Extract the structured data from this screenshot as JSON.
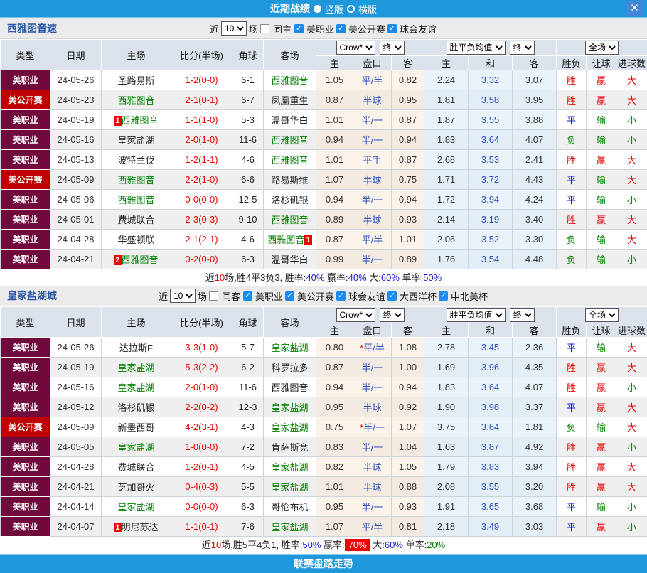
{
  "titlebar": {
    "title": "近期战绩",
    "radios": [
      {
        "label": "竖版",
        "selected": true
      },
      {
        "label": "横版",
        "selected": false
      }
    ],
    "close_label": "✕"
  },
  "header_cols": {
    "type": "类型",
    "date": "日期",
    "home": "主场",
    "score": "比分(半场)",
    "corner": "角球",
    "away": "客场",
    "sub": [
      "主",
      "盘口",
      "客",
      "主",
      "和",
      "客",
      "胜负",
      "让球",
      "进球数"
    ],
    "selects": {
      "crow": "Crow*",
      "final": "终",
      "avg": "胜平负均值",
      "scope": "全场"
    }
  },
  "colors": {
    "accent_blue": "#1f98db",
    "league_mls_bg": "#70093c",
    "league_usopen_bg": "#c00000",
    "focus_team_green": "#008000",
    "score_red": "#f20000",
    "win_red": "#e60000",
    "draw_blue": "#1616d8",
    "lose_green": "#008000",
    "checkbox_blue": "#1b8bf0"
  },
  "sections": [
    {
      "team": "西雅图音速",
      "filter": {
        "near": "近",
        "count": "10",
        "unit": "场",
        "same": {
          "label": "同主",
          "checked": false
        },
        "leagues": [
          {
            "label": "美职业",
            "checked": true
          },
          {
            "label": "美公开赛",
            "checked": true
          },
          {
            "label": "球会友谊",
            "checked": true
          }
        ]
      },
      "rows": [
        {
          "l": "美职业",
          "lc": "mls",
          "d": "24-05-26",
          "h": "圣路易斯",
          "hc": "",
          "hb": "",
          "hba": "",
          "s": "1-2(0-0)",
          "cn": "6-1",
          "a": "西雅图音",
          "ac": "g",
          "ab": "",
          "aba": "",
          "o1": "1.05",
          "p": "平/半",
          "st": false,
          "o2": "0.82",
          "m1": "2.24",
          "m2": "3.32",
          "m3": "3.07",
          "r1": "胜",
          "c1": "r",
          "r2": "赢",
          "c2": "r",
          "r3": "大",
          "c3": "r"
        },
        {
          "l": "美公开赛",
          "lc": "usoc",
          "d": "24-05-23",
          "h": "西雅图音",
          "hc": "g",
          "hb": "",
          "hba": "",
          "s": "2-1(0-1)",
          "cn": "6-7",
          "a": "凤凰重生",
          "ac": "",
          "ab": "",
          "aba": "",
          "o1": "0.87",
          "p": "半球",
          "st": false,
          "o2": "0.95",
          "m1": "1.81",
          "m2": "3.58",
          "m3": "3.95",
          "r1": "胜",
          "c1": "r",
          "r2": "赢",
          "c2": "r",
          "r3": "大",
          "c3": "r"
        },
        {
          "l": "美职业",
          "lc": "mls",
          "d": "24-05-19",
          "h": "西雅图音",
          "hc": "g",
          "hb": "1",
          "hba": "",
          "s": "1-1(1-0)",
          "cn": "5-3",
          "a": "温哥华白",
          "ac": "",
          "ab": "",
          "aba": "",
          "o1": "1.01",
          "p": "半/一",
          "st": false,
          "o2": "0.87",
          "m1": "1.87",
          "m2": "3.55",
          "m3": "3.88",
          "r1": "平",
          "c1": "b",
          "r2": "输",
          "c2": "g",
          "r3": "小",
          "c3": "g"
        },
        {
          "l": "美职业",
          "lc": "mls",
          "d": "24-05-16",
          "h": "皇家盐湖",
          "hc": "",
          "hb": "",
          "hba": "",
          "s": "2-0(1-0)",
          "cn": "11-6",
          "a": "西雅图音",
          "ac": "g",
          "ab": "",
          "aba": "",
          "o1": "0.94",
          "p": "半/一",
          "st": false,
          "o2": "0.94",
          "m1": "1.83",
          "m2": "3.64",
          "m3": "4.07",
          "r1": "负",
          "c1": "g",
          "r2": "输",
          "c2": "g",
          "r3": "小",
          "c3": "g"
        },
        {
          "l": "美职业",
          "lc": "mls",
          "d": "24-05-13",
          "h": "波特兰伐",
          "hc": "",
          "hb": "",
          "hba": "",
          "s": "1-2(1-1)",
          "cn": "4-6",
          "a": "西雅图音",
          "ac": "g",
          "ab": "",
          "aba": "",
          "o1": "1.01",
          "p": "平手",
          "st": false,
          "o2": "0.87",
          "m1": "2.68",
          "m2": "3.53",
          "m3": "2.41",
          "r1": "胜",
          "c1": "r",
          "r2": "赢",
          "c2": "r",
          "r3": "大",
          "c3": "r"
        },
        {
          "l": "美公开赛",
          "lc": "usoc",
          "d": "24-05-09",
          "h": "西雅图音",
          "hc": "g",
          "hb": "",
          "hba": "",
          "s": "2-2(1-0)",
          "cn": "6-6",
          "a": "路易斯维",
          "ac": "",
          "ab": "",
          "aba": "",
          "o1": "1.07",
          "p": "半球",
          "st": false,
          "o2": "0.75",
          "m1": "1.71",
          "m2": "3.72",
          "m3": "4.43",
          "r1": "平",
          "c1": "b",
          "r2": "输",
          "c2": "g",
          "r3": "大",
          "c3": "r"
        },
        {
          "l": "美职业",
          "lc": "mls",
          "d": "24-05-06",
          "h": "西雅图音",
          "hc": "g",
          "hb": "",
          "hba": "",
          "s": "0-0(0-0)",
          "cn": "12-5",
          "a": "洛杉矶银",
          "ac": "",
          "ab": "",
          "aba": "",
          "o1": "0.94",
          "p": "半/一",
          "st": false,
          "o2": "0.94",
          "m1": "1.72",
          "m2": "3.94",
          "m3": "4.24",
          "r1": "平",
          "c1": "b",
          "r2": "输",
          "c2": "g",
          "r3": "小",
          "c3": "g"
        },
        {
          "l": "美职业",
          "lc": "mls",
          "d": "24-05-01",
          "h": "费城联合",
          "hc": "",
          "hb": "",
          "hba": "",
          "s": "2-3(0-3)",
          "cn": "9-10",
          "a": "西雅图音",
          "ac": "g",
          "ab": "",
          "aba": "",
          "o1": "0.89",
          "p": "半球",
          "st": false,
          "o2": "0.93",
          "m1": "2.14",
          "m2": "3.19",
          "m3": "3.40",
          "r1": "胜",
          "c1": "r",
          "r2": "赢",
          "c2": "r",
          "r3": "大",
          "c3": "r"
        },
        {
          "l": "美职业",
          "lc": "mls",
          "d": "24-04-28",
          "h": "华盛顿联",
          "hc": "",
          "hb": "",
          "hba": "",
          "s": "2-1(2-1)",
          "cn": "4-6",
          "a": "西雅图音",
          "ac": "g",
          "ab": "",
          "aba": "1",
          "o1": "0.87",
          "p": "平/半",
          "st": false,
          "o2": "1.01",
          "m1": "2.06",
          "m2": "3.52",
          "m3": "3.30",
          "r1": "负",
          "c1": "g",
          "r2": "输",
          "c2": "g",
          "r3": "大",
          "c3": "r"
        },
        {
          "l": "美职业",
          "lc": "mls",
          "d": "24-04-21",
          "h": "西雅图音",
          "hc": "g",
          "hb": "2",
          "hba": "",
          "s": "0-2(0-0)",
          "cn": "6-3",
          "a": "温哥华白",
          "ac": "",
          "ab": "",
          "aba": "",
          "o1": "0.99",
          "p": "半/一",
          "st": false,
          "o2": "0.89",
          "m1": "1.76",
          "m2": "3.54",
          "m3": "4.48",
          "r1": "负",
          "c1": "g",
          "r2": "输",
          "c2": "g",
          "r3": "小",
          "c3": "g"
        }
      ],
      "summary": [
        {
          "t": "近",
          "c": "k"
        },
        {
          "t": "10",
          "c": "r"
        },
        {
          "t": "场,胜4平3负3, 胜率:",
          "c": "k"
        },
        {
          "t": "40%",
          "c": "b"
        },
        {
          "t": " 赢率:",
          "c": "k"
        },
        {
          "t": "40%",
          "c": "b"
        },
        {
          "t": " 大:",
          "c": "k"
        },
        {
          "t": "60%",
          "c": "b"
        },
        {
          "t": " 单率:",
          "c": "k"
        },
        {
          "t": "50%",
          "c": "b"
        }
      ]
    },
    {
      "team": "皇家盐湖城",
      "filter": {
        "near": "近",
        "count": "10",
        "unit": "场",
        "same": {
          "label": "同客",
          "checked": false
        },
        "leagues": [
          {
            "label": "美职业",
            "checked": true
          },
          {
            "label": "美公开赛",
            "checked": true
          },
          {
            "label": "球会友谊",
            "checked": true
          },
          {
            "label": "大西洋杯",
            "checked": true
          },
          {
            "label": "中北美杯",
            "checked": true
          }
        ]
      },
      "rows": [
        {
          "l": "美职业",
          "lc": "mls",
          "d": "24-05-26",
          "h": "达拉斯F",
          "hc": "",
          "hb": "",
          "hba": "",
          "s": "3-3(1-0)",
          "cn": "5-7",
          "a": "皇家盐湖",
          "ac": "g",
          "ab": "",
          "aba": "",
          "o1": "0.80",
          "p": "平/半",
          "st": true,
          "o2": "1.08",
          "m1": "2.78",
          "m2": "3.45",
          "m3": "2.36",
          "r1": "平",
          "c1": "b",
          "r2": "输",
          "c2": "g",
          "r3": "大",
          "c3": "r"
        },
        {
          "l": "美职业",
          "lc": "mls",
          "d": "24-05-19",
          "h": "皇家盐湖",
          "hc": "g",
          "hb": "",
          "hba": "",
          "s": "5-3(2-2)",
          "cn": "6-2",
          "a": "科罗拉多",
          "ac": "",
          "ab": "",
          "aba": "",
          "o1": "0.87",
          "p": "半/一",
          "st": false,
          "o2": "1.00",
          "m1": "1.69",
          "m2": "3.96",
          "m3": "4.35",
          "r1": "胜",
          "c1": "r",
          "r2": "赢",
          "c2": "r",
          "r3": "大",
          "c3": "r"
        },
        {
          "l": "美职业",
          "lc": "mls",
          "d": "24-05-16",
          "h": "皇家盐湖",
          "hc": "g",
          "hb": "",
          "hba": "",
          "s": "2-0(1-0)",
          "cn": "11-6",
          "a": "西雅图音",
          "ac": "",
          "ab": "",
          "aba": "",
          "o1": "0.94",
          "p": "半/一",
          "st": false,
          "o2": "0.94",
          "m1": "1.83",
          "m2": "3.64",
          "m3": "4.07",
          "r1": "胜",
          "c1": "r",
          "r2": "赢",
          "c2": "r",
          "r3": "小",
          "c3": "g"
        },
        {
          "l": "美职业",
          "lc": "mls",
          "d": "24-05-12",
          "h": "洛杉矶银",
          "hc": "",
          "hb": "",
          "hba": "",
          "s": "2-2(0-2)",
          "cn": "12-3",
          "a": "皇家盐湖",
          "ac": "g",
          "ab": "",
          "aba": "",
          "o1": "0.95",
          "p": "半球",
          "st": false,
          "o2": "0.92",
          "m1": "1.90",
          "m2": "3.98",
          "m3": "3.37",
          "r1": "平",
          "c1": "b",
          "r2": "赢",
          "c2": "r",
          "r3": "大",
          "c3": "r"
        },
        {
          "l": "美公开赛",
          "lc": "usoc",
          "d": "24-05-09",
          "h": "新墨西哥",
          "hc": "",
          "hb": "",
          "hba": "",
          "s": "4-2(3-1)",
          "cn": "4-3",
          "a": "皇家盐湖",
          "ac": "g",
          "ab": "",
          "aba": "",
          "o1": "0.75",
          "p": "半/一",
          "st": true,
          "o2": "1.07",
          "m1": "3.75",
          "m2": "3.64",
          "m3": "1.81",
          "r1": "负",
          "c1": "g",
          "r2": "输",
          "c2": "g",
          "r3": "大",
          "c3": "r"
        },
        {
          "l": "美职业",
          "lc": "mls",
          "d": "24-05-05",
          "h": "皇家盐湖",
          "hc": "g",
          "hb": "",
          "hba": "",
          "s": "1-0(0-0)",
          "cn": "7-2",
          "a": "肯萨斯竞",
          "ac": "",
          "ab": "",
          "aba": "",
          "o1": "0.83",
          "p": "半/一",
          "st": false,
          "o2": "1.04",
          "m1": "1.63",
          "m2": "3.87",
          "m3": "4.92",
          "r1": "胜",
          "c1": "r",
          "r2": "赢",
          "c2": "r",
          "r3": "小",
          "c3": "g"
        },
        {
          "l": "美职业",
          "lc": "mls",
          "d": "24-04-28",
          "h": "费城联合",
          "hc": "",
          "hb": "",
          "hba": "",
          "s": "1-2(0-1)",
          "cn": "4-5",
          "a": "皇家盐湖",
          "ac": "g",
          "ab": "",
          "aba": "",
          "o1": "0.82",
          "p": "半球",
          "st": false,
          "o2": "1.05",
          "m1": "1.79",
          "m2": "3.83",
          "m3": "3.94",
          "r1": "胜",
          "c1": "r",
          "r2": "赢",
          "c2": "r",
          "r3": "大",
          "c3": "r"
        },
        {
          "l": "美职业",
          "lc": "mls",
          "d": "24-04-21",
          "h": "芝加哥火",
          "hc": "",
          "hb": "",
          "hba": "",
          "s": "0-4(0-3)",
          "cn": "5-5",
          "a": "皇家盐湖",
          "ac": "g",
          "ab": "",
          "aba": "",
          "o1": "1.01",
          "p": "半球",
          "st": false,
          "o2": "0.88",
          "m1": "2.08",
          "m2": "3.55",
          "m3": "3.20",
          "r1": "胜",
          "c1": "r",
          "r2": "赢",
          "c2": "r",
          "r3": "大",
          "c3": "r"
        },
        {
          "l": "美职业",
          "lc": "mls",
          "d": "24-04-14",
          "h": "皇家盐湖",
          "hc": "g",
          "hb": "",
          "hba": "",
          "s": "0-0(0-0)",
          "cn": "6-3",
          "a": "哥伦布机",
          "ac": "",
          "ab": "",
          "aba": "",
          "o1": "0.95",
          "p": "半/一",
          "st": false,
          "o2": "0.93",
          "m1": "1.91",
          "m2": "3.65",
          "m3": "3.68",
          "r1": "平",
          "c1": "b",
          "r2": "输",
          "c2": "g",
          "r3": "小",
          "c3": "g"
        },
        {
          "l": "美职业",
          "lc": "mls",
          "d": "24-04-07",
          "h": "明尼苏达",
          "hc": "",
          "hb": "1",
          "hba": "",
          "s": "1-1(0-1)",
          "cn": "7-6",
          "a": "皇家盐湖",
          "ac": "g",
          "ab": "",
          "aba": "",
          "o1": "1.07",
          "p": "平/半",
          "st": false,
          "o2": "0.81",
          "m1": "2.18",
          "m2": "3.49",
          "m3": "3.03",
          "r1": "平",
          "c1": "b",
          "r2": "赢",
          "c2": "r",
          "r3": "小",
          "c3": "g"
        }
      ],
      "summary": [
        {
          "t": "近",
          "c": "k"
        },
        {
          "t": "10",
          "c": "r"
        },
        {
          "t": "场,胜5平4负1, 胜率:",
          "c": "k"
        },
        {
          "t": "50%",
          "c": "b"
        },
        {
          "t": " 赢率:",
          "c": "k"
        },
        {
          "t": "70%",
          "c": "rb"
        },
        {
          "t": " 大:",
          "c": "k"
        },
        {
          "t": "60%",
          "c": "b"
        },
        {
          "t": " 单率:",
          "c": "k"
        },
        {
          "t": "20%",
          "c": "g"
        }
      ]
    }
  ],
  "footer": {
    "label": "联赛盘路走势"
  }
}
